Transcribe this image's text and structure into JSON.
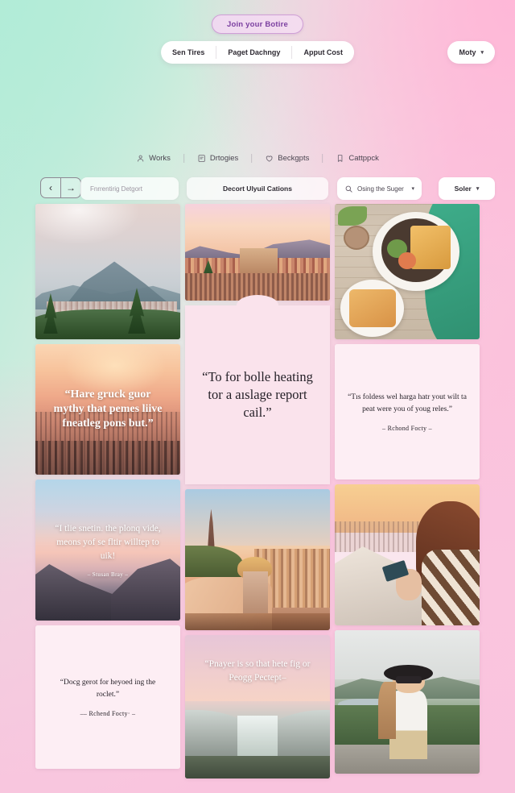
{
  "topbar": {
    "join_label": "Join your Botire",
    "nav_items": [
      "Sen Tires",
      "Paget Dachngy",
      "Apput Cost"
    ],
    "account_label": "Moty"
  },
  "iconnav": {
    "items": [
      {
        "label": "Works",
        "icon": "user-icon"
      },
      {
        "label": "Drtogies",
        "icon": "book-icon"
      },
      {
        "label": "Beckgpts",
        "icon": "heart-icon"
      },
      {
        "label": "Cattppck",
        "icon": "bookmark-icon"
      }
    ]
  },
  "filters": {
    "prev_label": "‹",
    "next_label": "→",
    "search_placeholder": "Fnrrentirig Detgort",
    "center_label": "Decort Ulyuil Cations",
    "sugar_label": "Osing the Suger",
    "sugar_caret": "⌄",
    "sort_label": "Soler",
    "sort_caret": "⌄",
    "search_icon": "search-icon"
  },
  "grid": {
    "columns": [
      {
        "cards": [
          {
            "type": "photo",
            "name": "card-mountain-valley",
            "scene": "mountain-valley",
            "height": "h168"
          },
          {
            "type": "photo-quote",
            "name": "card-sunset-city-quote",
            "scene": "sunset-city",
            "height": "h162",
            "quote": "“Hare gruck guor mythy that pemes liive fneatleg pons but.”"
          },
          {
            "type": "photo-quote",
            "name": "card-dawn-mountain-quote",
            "scene": "dawn-mountain",
            "height": "h175",
            "quote": "“I tlie snetin. the plonq vide, meons yof se fltir willtep to uik!",
            "attribution": "– Stusan Bray –"
          },
          {
            "type": "paper",
            "name": "card-quote-rocket",
            "height": "h178",
            "style": "light",
            "quote": "“Docg gerot for heyoed ing the roclet.”",
            "attribution": "–– Rchend Focty· –"
          }
        ]
      },
      {
        "cards": [
          {
            "type": "photo",
            "name": "card-town-hillside",
            "scene": "sunset-town",
            "height": "h120"
          },
          {
            "type": "paper",
            "name": "card-quote-report",
            "height": "h222",
            "notch": true,
            "quote": "“To for bolle heating tor a aıslage report cail.”"
          },
          {
            "type": "photo",
            "name": "card-eiffel-selfie",
            "scene": "paris",
            "height": "h175"
          },
          {
            "type": "photo-quote",
            "name": "card-waterfall-quote",
            "scene": "waterfall",
            "height": "h178",
            "quote": "“Pnayer is so that hete fig or Peogg Pectept–"
          }
        ]
      },
      {
        "cards": [
          {
            "type": "photo",
            "name": "card-breakfast-table",
            "scene": "food-table",
            "height": "h168"
          },
          {
            "type": "paper",
            "name": "card-quote-foldess",
            "height": "h168",
            "style": "light",
            "quote": "“Tıs foldess wel harga hatr yout wilt ta peat were you of youg reles.”",
            "attribution": "– Rchond Focty –"
          },
          {
            "type": "photo",
            "name": "card-rooftop-phone",
            "scene": "rooftop",
            "height": "h175"
          },
          {
            "type": "photo",
            "name": "card-woman-hat-lake",
            "scene": "lake-hill",
            "height": "h178"
          }
        ]
      }
    ]
  },
  "colors": {
    "accent_purple": "#7b3fa0",
    "bg_mint": "#b9ead8",
    "bg_pink": "#fac3dd",
    "card_paper": "#fae3ec",
    "card_paper_light": "#fdeef4"
  }
}
